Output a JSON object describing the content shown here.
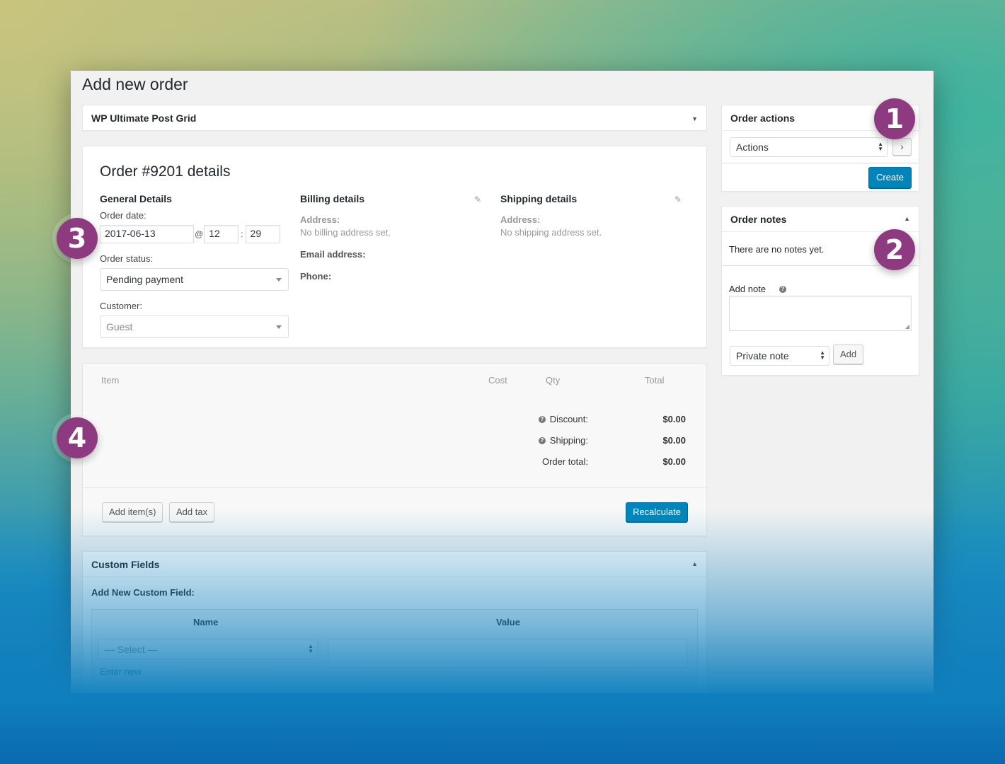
{
  "page": {
    "title": "Add new order"
  },
  "plugin_panel": {
    "title": "WP Ultimate Post Grid"
  },
  "order": {
    "heading": "Order #9201 details",
    "general": {
      "title": "General Details",
      "date_label": "Order date:",
      "date": "2017-06-13",
      "at": "@",
      "hour": "12",
      "colon": ":",
      "minute": "29",
      "status_label": "Order status:",
      "status": "Pending payment",
      "customer_label": "Customer:",
      "customer": "Guest"
    },
    "billing": {
      "title": "Billing details",
      "address_label": "Address:",
      "address_value": "No billing address set.",
      "email_label": "Email address:",
      "phone_label": "Phone:"
    },
    "shipping": {
      "title": "Shipping details",
      "address_label": "Address:",
      "address_value": "No shipping address set."
    }
  },
  "items": {
    "columns": {
      "item": "Item",
      "cost": "Cost",
      "qty": "Qty",
      "total": "Total"
    },
    "totals": [
      {
        "label": "Discount:",
        "value": "$0.00",
        "help": true
      },
      {
        "label": "Shipping:",
        "value": "$0.00",
        "help": true
      },
      {
        "label": "Order total:",
        "value": "$0.00",
        "help": false
      }
    ],
    "help_glyph": "?",
    "add_items_button": "Add item(s)",
    "add_tax_button": "Add tax",
    "recalculate_button": "Recalculate"
  },
  "custom_fields": {
    "title": "Custom Fields",
    "subtitle": "Add New Custom Field:",
    "name_header": "Name",
    "value_header": "Value",
    "select_placeholder": "— Select —",
    "enter_new_link": "Enter new"
  },
  "order_actions": {
    "title": "Order actions",
    "select_value": "Actions",
    "go_button": "›",
    "create_button": "Create"
  },
  "order_notes": {
    "title": "Order notes",
    "empty_text": "There are no notes yet.",
    "add_note_label": "Add note",
    "note_type": "Private note",
    "add_button": "Add"
  },
  "badges": [
    "1",
    "2",
    "3",
    "4"
  ],
  "colors": {
    "accent": "#0085ba",
    "badge": "#8e3a80",
    "window_bg": "#f1f1f1"
  },
  "icons": [
    "pencil-icon",
    "help-icon",
    "chevron-right-icon",
    "caret-down-icon",
    "caret-up-icon"
  ]
}
